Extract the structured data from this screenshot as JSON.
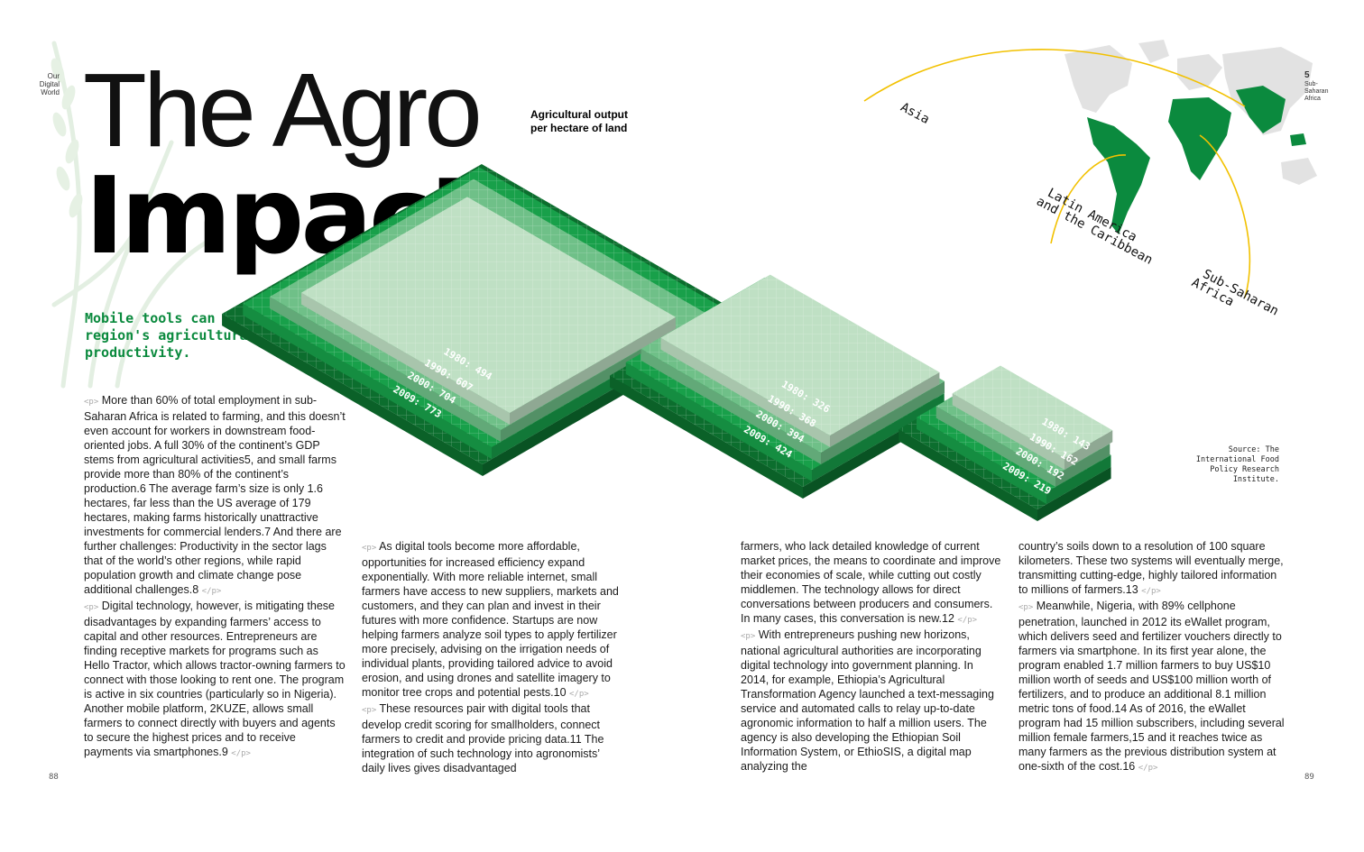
{
  "brand": {
    "lines": [
      "Our",
      "Digital",
      "World"
    ]
  },
  "title": {
    "line1": "The Agro",
    "line2": "Impact"
  },
  "subtitle": "Mobile tools can help improve the region's agricultural productivity.",
  "chart_label": "Agricultural output per hectare of land",
  "map_label": {
    "number": "5",
    "text": "Sub-Saharan Africa"
  },
  "source": "Source: The International Food Policy Research Institute.",
  "page_left": "88",
  "page_right": "89",
  "tags": {
    "open": "<p>",
    "close": "</p>"
  },
  "colors": {
    "accent": "#0b8a3e",
    "y1980": "#bfe0c4",
    "y1990": "#6fc088",
    "y2000": "#18a04a",
    "y2009": "#0c6e2e"
  },
  "chart_data": {
    "type": "bar",
    "title": "Agricultural output per hectare of land",
    "series_order": [
      "1980",
      "1990",
      "2000",
      "2009"
    ],
    "regions": [
      {
        "name": "Asia",
        "values": {
          "1980": 494,
          "1990": 607,
          "2000": 704,
          "2009": 773
        },
        "labels": [
          "1980: 494",
          "1990: 607",
          "2000: 704",
          "2009: 773"
        ]
      },
      {
        "name": "Latin America and the Caribbean",
        "values": {
          "1980": 326,
          "1990": 368,
          "2000": 394,
          "2009": 424
        },
        "labels": [
          "1980: 326",
          "1990: 368",
          "2000: 394",
          "2009: 424"
        ]
      },
      {
        "name": "Sub-Saharan Africa",
        "values": {
          "1980": 143,
          "1990": 162,
          "2000": 192,
          "2009": 219
        },
        "labels": [
          "1980: 143",
          "1990: 162",
          "2000: 192",
          "2009: 219"
        ]
      }
    ]
  },
  "columns": [
    {
      "paragraphs": [
        "More than 60% of total employment in sub-Saharan Africa is related to farming, and this doesn’t even account for workers in downstream food-oriented jobs. A full 30% of the continent’s GDP stems from agricultural activities5, and small farms provide more than 80% of the continent’s production.6 The average farm’s size is only 1.6 hectares, far less than the US average of 179 hectares, making farms historically unattractive investments for commercial lenders.7 And there are further challenges: Productivity in the sector lags that of the world’s other regions, while rapid population growth and climate change pose additional challenges.8",
        "Digital technology, however, is mitigating these disadvantages by expanding farmers’ access to capital and other resources. Entrepreneurs are finding receptive markets for programs such as Hello Tractor, which allows tractor-owning farmers to connect with those looking to rent one. The program is active in six countries (particularly so in Nigeria). Another mobile platform, 2KUZE, allows small farmers to connect directly with buyers and agents to secure the highest prices and to receive payments via smartphones.9"
      ]
    },
    {
      "paragraphs": [
        "As digital tools become more affordable, opportunities for increased efficiency expand exponentially. With more reliable internet, small farmers have access to new suppliers, markets and customers, and they can plan and invest in their futures with more confidence. Startups are now helping farmers analyze soil types to apply fertilizer more precisely, advising on the irrigation needs of individual plants, providing tailored advice to avoid erosion, and using drones and satellite imagery to monitor tree crops and potential pests.10",
        "These resources pair with digital tools that develop credit scoring for smallholders, connect farmers to credit and provide pricing data.11 The integration of such technology into agronomists’ daily lives gives disadvantaged"
      ]
    },
    {
      "paragraphs": [
        "farmers, who lack detailed knowledge of current market prices, the means to coordinate and improve their economies of scale, while cutting out costly middlemen. The technology allows for direct conversations between producers and consumers. In many cases, this conversation is new.12",
        "With entrepreneurs pushing new horizons, national agricultural authorities are incorporating digital technology into government planning. In 2014, for example, Ethiopia’s Agricultural Transformation Agency launched a text-messaging service and automated calls to relay up-to-date agronomic information to half a million users. The agency is also developing the Ethiopian Soil Information System, or EthioSIS, a digital map analyzing the"
      ]
    },
    {
      "paragraphs": [
        "country’s soils down to a resolution of 100 square kilometers. These two systems will eventually merge, transmitting cutting-edge, highly tailored information to millions of farmers.13",
        "Meanwhile, Nigeria, with 89% cellphone penetration, launched in 2012 its eWallet program, which delivers seed and fertilizer vouchers directly to farmers via smartphone. In its first year alone, the program enabled 1.7 million farmers to buy US$10 million worth of seeds and US$100 million worth of fertilizers, and to produce an additional 8.1 million metric tons of food.14 As of 2016, the eWallet program had 15 million subscribers, including several million female farmers,15 and it reaches twice as many farmers as the previous distribution system at one-sixth of the cost.16"
      ]
    }
  ]
}
